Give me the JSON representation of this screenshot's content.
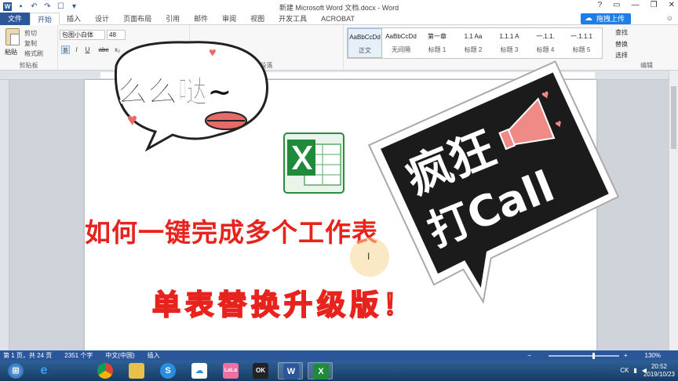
{
  "window": {
    "title": "新建 Microsoft Word 文档.docx - Word",
    "controls": [
      "?",
      "▭",
      "—",
      "❐",
      "✕"
    ]
  },
  "tabs": [
    "文件",
    "开始",
    "插入",
    "设计",
    "页面布局",
    "引用",
    "邮件",
    "审阅",
    "视图",
    "开发工具",
    "ACROBAT"
  ],
  "upload_button": "拖拽上传",
  "ribbon": {
    "clipboard": {
      "paste": "粘贴",
      "cut": "剪切",
      "copy": "复制",
      "format_painter": "格式刷",
      "label": "剪贴板"
    },
    "font": {
      "name": "包图小白体",
      "size": "48",
      "bold": "B",
      "italic": "I",
      "underline": "U",
      "strike": "abc",
      "sub": "x₂"
    },
    "paragraph_label": "段落",
    "styles": [
      {
        "sample": "AaBbCcDd",
        "name": "正文"
      },
      {
        "sample": "AaBbCcDd",
        "name": "无间隔"
      },
      {
        "sample": "第一章",
        "name": "标题 1"
      },
      {
        "sample": "1.1 Aa",
        "name": "标题 2"
      },
      {
        "sample": "1.1.1 A",
        "name": "标题 3"
      },
      {
        "sample": "一.1.1.",
        "name": "标题 4"
      },
      {
        "sample": "一.1.1.1",
        "name": "标题 5"
      }
    ],
    "editing": {
      "find": "查找",
      "replace": "替换",
      "select": "选择",
      "label": "编辑"
    }
  },
  "document": {
    "headline": "如何一键完成多个工作表",
    "subline": "单表替换升级版！"
  },
  "stickers": {
    "left_text": "么么哒~",
    "right_lines": [
      "疯狂",
      "打Call"
    ]
  },
  "statusbar": {
    "page": "第 1 页，共 24 页",
    "words": "2351 个字",
    "language": "中文(中国)",
    "mode": "插入",
    "zoom": "130%",
    "zoom_fraction": 0.62
  },
  "taskbar": {
    "apps": [
      "start",
      "ie",
      "chrome",
      "explorer",
      "sogou",
      "baidu",
      "lala",
      "obs",
      "word",
      "excel"
    ],
    "tray": "CK",
    "time": "20:52",
    "date": "2019/10/23"
  },
  "colors": {
    "accent": "#2b579a",
    "headline": "#e8221c",
    "upload": "#1e7de6"
  }
}
